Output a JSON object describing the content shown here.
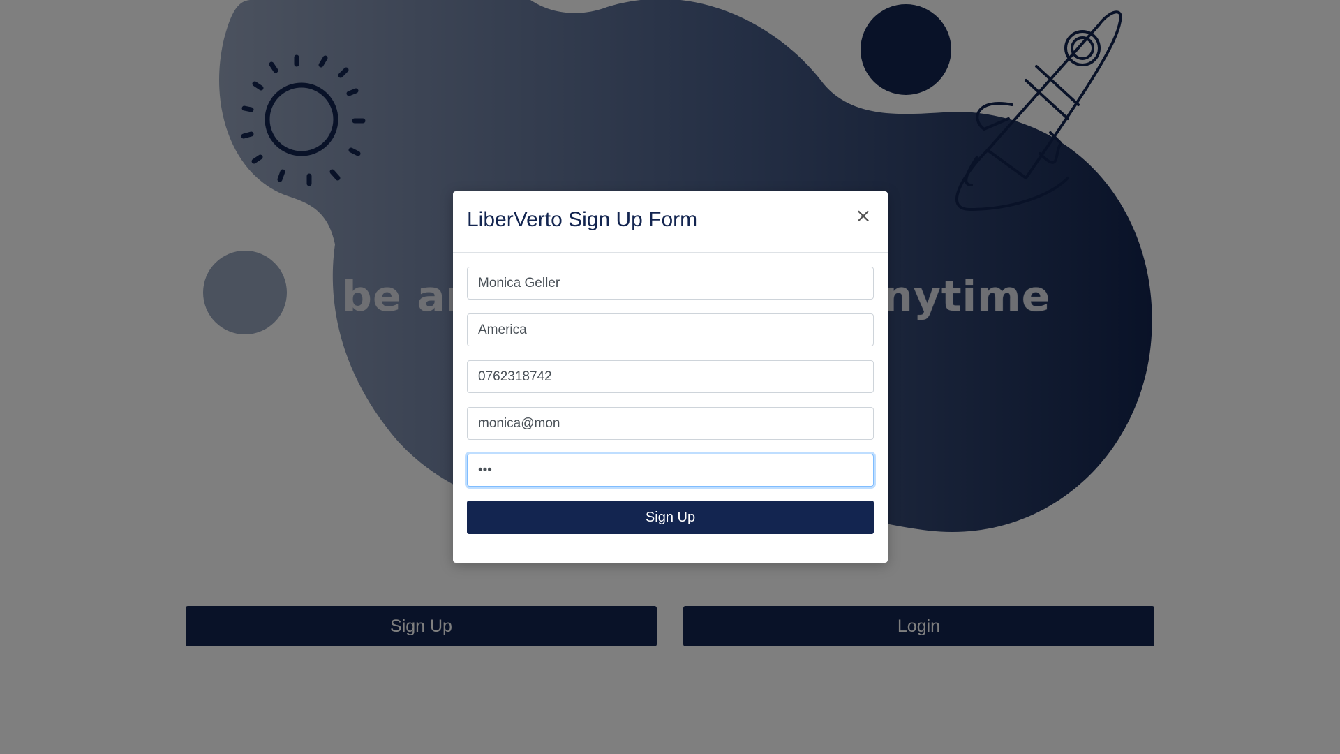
{
  "page": {
    "tagline": "be an explorer, start anytime",
    "signup_button": "Sign Up",
    "login_button": "Login"
  },
  "modal": {
    "title": "LiberVerto Sign Up Form",
    "close_glyph": "×",
    "fields": {
      "name": "Monica Geller",
      "country": "America",
      "phone": "0762318742",
      "email": "monica@mon",
      "password": "•••"
    },
    "submit_label": "Sign Up"
  },
  "colors": {
    "brand_navy": "#132550",
    "backdrop": "rgba(0,0,0,0.5)",
    "focus_ring": "#80bdff"
  },
  "icons": [
    "sun-icon",
    "rocket-icon",
    "close-icon"
  ]
}
